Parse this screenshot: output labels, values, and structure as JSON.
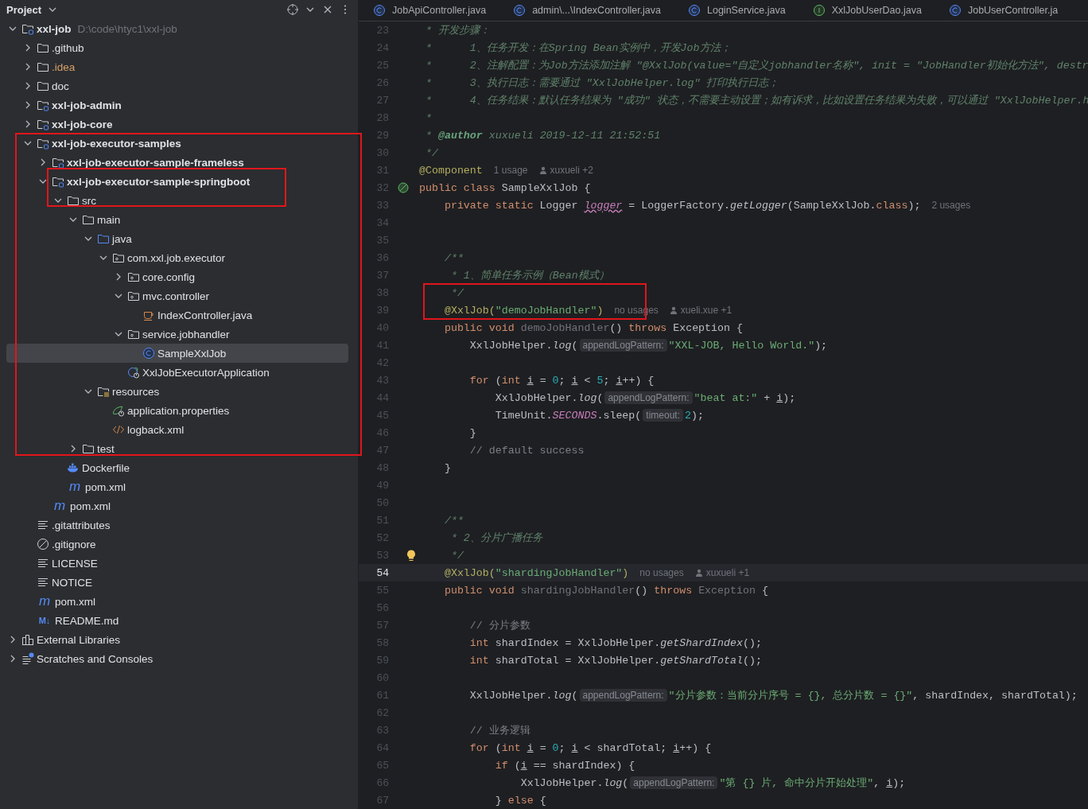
{
  "project_panel": {
    "title": "Project"
  },
  "tree": [
    {
      "label": "xxl-job",
      "kind": "module",
      "path": "D:\\code\\htyc1\\xxl-job",
      "expanded": true,
      "selected": false,
      "children": [
        {
          "label": ".github",
          "kind": "folder",
          "ignored": false,
          "expanded": false,
          "selected": false
        },
        {
          "label": ".idea",
          "kind": "folder",
          "ignored": true,
          "expanded": false,
          "selected": false
        },
        {
          "label": "doc",
          "kind": "folder",
          "ignored": false,
          "expanded": false,
          "selected": false
        },
        {
          "label": "xxl-job-admin",
          "kind": "module",
          "ignored": false,
          "expanded": false,
          "selected": false
        },
        {
          "label": "xxl-job-core",
          "kind": "module",
          "ignored": false,
          "expanded": false,
          "selected": false
        },
        {
          "label": "xxl-job-executor-samples",
          "kind": "module",
          "ignored": false,
          "expanded": true,
          "selected": false,
          "children": [
            {
              "label": "xxl-job-executor-sample-frameless",
              "kind": "module",
              "expanded": false,
              "selected": false
            },
            {
              "label": "xxl-job-executor-sample-springboot",
              "kind": "module",
              "expanded": true,
              "selected": false,
              "children": [
                {
                  "label": "src",
                  "kind": "folder",
                  "expanded": true,
                  "selected": false,
                  "children": [
                    {
                      "label": "main",
                      "kind": "folder",
                      "expanded": true,
                      "selected": false,
                      "children": [
                        {
                          "label": "java",
                          "kind": "source",
                          "expanded": true,
                          "selected": false,
                          "children": [
                            {
                              "label": "com.xxl.job.executor",
                              "kind": "package",
                              "expanded": true,
                              "selected": false,
                              "children": [
                                {
                                  "label": "core.config",
                                  "kind": "package",
                                  "expanded": false,
                                  "selected": false
                                },
                                {
                                  "label": "mvc.controller",
                                  "kind": "package",
                                  "expanded": true,
                                  "selected": false,
                                  "children": [
                                    {
                                      "label": "IndexController.java",
                                      "kind": "javafile",
                                      "selected": false
                                    }
                                  ]
                                },
                                {
                                  "label": "service.jobhandler",
                                  "kind": "package",
                                  "expanded": true,
                                  "selected": false,
                                  "children": [
                                    {
                                      "label": "SampleXxlJob",
                                      "kind": "class",
                                      "selected": true
                                    }
                                  ]
                                },
                                {
                                  "label": "XxlJobExecutorApplication",
                                  "kind": "springapp",
                                  "selected": false
                                }
                              ]
                            }
                          ]
                        },
                        {
                          "label": "resources",
                          "kind": "resources",
                          "expanded": true,
                          "selected": false,
                          "children": [
                            {
                              "label": "application.properties",
                              "kind": "properties",
                              "selected": false
                            },
                            {
                              "label": "logback.xml",
                              "kind": "xml",
                              "selected": false
                            }
                          ]
                        }
                      ]
                    },
                    {
                      "label": "test",
                      "kind": "folder",
                      "expanded": false,
                      "selected": false
                    }
                  ]
                },
                {
                  "label": "Dockerfile",
                  "kind": "docker",
                  "selected": false
                },
                {
                  "label": "pom.xml",
                  "kind": "maven",
                  "icon_text": "m",
                  "selected": false
                }
              ]
            },
            {
              "label": "pom.xml",
              "kind": "maven",
              "icon_text": "m",
              "selected": false
            }
          ]
        },
        {
          "label": ".gitattributes",
          "kind": "text",
          "ignored": false,
          "selected": false
        },
        {
          "label": ".gitignore",
          "kind": "ignore",
          "ignored": false,
          "selected": false
        },
        {
          "label": "LICENSE",
          "kind": "text",
          "ignored": false,
          "selected": false
        },
        {
          "label": "NOTICE",
          "kind": "text",
          "ignored": false,
          "selected": false
        },
        {
          "label": "pom.xml",
          "kind": "maven",
          "icon_text": "m",
          "ignored": false,
          "selected": false
        },
        {
          "label": "README.md",
          "kind": "markdown",
          "icon_text": "M↓",
          "ignored": false,
          "selected": false
        }
      ]
    },
    {
      "label": "External Libraries",
      "kind": "libraries",
      "expanded": false,
      "selected": false
    },
    {
      "label": "Scratches and Consoles",
      "kind": "scratches",
      "expanded": false,
      "selected": false
    }
  ],
  "editor_tabs": [
    {
      "label": "JobApiController.java",
      "kind": "class",
      "selected": false
    },
    {
      "label": "admin\\...\\IndexController.java",
      "kind": "class",
      "selected": false
    },
    {
      "label": "LoginService.java",
      "kind": "class",
      "selected": false
    },
    {
      "label": "XxlJobUserDao.java",
      "kind": "interface",
      "selected": false
    },
    {
      "label": "JobUserController.ja",
      "kind": "class",
      "selected": false
    }
  ],
  "editor": {
    "lines": [
      {
        "number": "23",
        "parts": [
          {
            "kind": "code",
            "tokens": [
              {
                "kind": "doc",
                "text": " * 开发步骤："
              }
            ]
          }
        ]
      },
      {
        "number": "24",
        "parts": [
          {
            "kind": "code",
            "tokens": [
              {
                "kind": "doc",
                "text": " *      1、任务开发：在Spring Bean实例中，开发Job方法；"
              }
            ]
          }
        ]
      },
      {
        "number": "25",
        "parts": [
          {
            "kind": "code",
            "tokens": [
              {
                "kind": "doc",
                "text": " *      2、注解配置：为Job方法添加注解 \"@XxlJob(value=\"自定义jobhandler名称\", init = \"JobHandler初始化方法\", destr"
              }
            ]
          }
        ]
      },
      {
        "number": "26",
        "parts": [
          {
            "kind": "code",
            "tokens": [
              {
                "kind": "doc",
                "text": " *      3、执行日志：需要通过 \"XxlJobHelper.log\" 打印执行日志；"
              }
            ]
          }
        ]
      },
      {
        "number": "27",
        "parts": [
          {
            "kind": "code",
            "tokens": [
              {
                "kind": "doc",
                "text": " *      4、任务结果：默认任务结果为 \"成功\" 状态，不需要主动设置；如有诉求，比如设置任务结果为失败，可以通过 \"XxlJobHelper.h"
              }
            ]
          }
        ]
      },
      {
        "number": "28",
        "parts": [
          {
            "kind": "code",
            "tokens": [
              {
                "kind": "doc",
                "text": " *"
              }
            ]
          }
        ]
      },
      {
        "number": "29",
        "parts": [
          {
            "kind": "code",
            "tokens": [
              {
                "kind": "doc",
                "text": " * "
              },
              {
                "kind": "doctag",
                "text": "@author"
              },
              {
                "kind": "doc",
                "text": " xuxueli 2019-12-11 21:52:51"
              }
            ]
          }
        ]
      },
      {
        "number": "30",
        "parts": [
          {
            "kind": "code",
            "tokens": [
              {
                "kind": "doc",
                "text": " */"
              }
            ]
          }
        ]
      },
      {
        "number": "31",
        "parts": [
          {
            "kind": "code",
            "tokens": [
              {
                "kind": "ann",
                "text": "@Component"
              }
            ]
          },
          {
            "kind": "usage",
            "text": "1 usage"
          },
          {
            "kind": "author",
            "text": "xuxueli +2"
          }
        ]
      },
      {
        "number": "32",
        "gutter": {
          "kind": "bean"
        },
        "parts": [
          {
            "kind": "code",
            "tokens": [
              {
                "kind": "kw",
                "text": "public class "
              },
              {
                "kind": "plain",
                "text": "SampleXxlJob {"
              }
            ]
          }
        ]
      },
      {
        "number": "33",
        "parts": [
          {
            "kind": "code",
            "tokens": [
              {
                "kind": "kw",
                "text": "    private static "
              },
              {
                "kind": "plain",
                "text": "Logger "
              },
              {
                "kind": "field",
                "text": "logger"
              },
              {
                "kind": "plain",
                "text": " = LoggerFactory."
              },
              {
                "kind": "ital",
                "text": "getLogger"
              },
              {
                "kind": "plain",
                "text": "(SampleXxlJob."
              },
              {
                "kind": "kw",
                "text": "class"
              },
              {
                "kind": "plain",
                "text": ");"
              }
            ]
          },
          {
            "kind": "usage",
            "text": "2 usages"
          }
        ]
      },
      {
        "number": "34"
      },
      {
        "number": "35"
      },
      {
        "number": "36",
        "parts": [
          {
            "kind": "code",
            "tokens": [
              {
                "kind": "doc",
                "text": "    /**"
              }
            ]
          }
        ]
      },
      {
        "number": "37",
        "parts": [
          {
            "kind": "code",
            "tokens": [
              {
                "kind": "doc",
                "text": "     * 1、简单任务示例（Bean模式）"
              }
            ]
          }
        ]
      },
      {
        "number": "38",
        "parts": [
          {
            "kind": "code",
            "tokens": [
              {
                "kind": "doc",
                "text": "     */"
              }
            ]
          }
        ]
      },
      {
        "number": "39",
        "parts": [
          {
            "kind": "code",
            "tokens": [
              {
                "kind": "ann",
                "text": "    @XxlJob("
              },
              {
                "kind": "str",
                "text": "\"demoJobHandler\""
              },
              {
                "kind": "ann",
                "text": ")"
              }
            ]
          },
          {
            "kind": "usage",
            "text": "no usages"
          },
          {
            "kind": "author",
            "text": "xueli.xue +1"
          }
        ]
      },
      {
        "number": "40",
        "parts": [
          {
            "kind": "code",
            "tokens": [
              {
                "kind": "kw",
                "text": "    public void "
              },
              {
                "kind": "unused",
                "text": "demoJobHandler"
              },
              {
                "kind": "plain",
                "text": "() "
              },
              {
                "kind": "kw",
                "text": "throws "
              },
              {
                "kind": "plain",
                "text": "Exception {"
              }
            ]
          }
        ]
      },
      {
        "number": "41",
        "parts": [
          {
            "kind": "code",
            "tokens": [
              {
                "kind": "plain",
                "text": "        XxlJobHelper."
              },
              {
                "kind": "ital",
                "text": "log"
              },
              {
                "kind": "plain",
                "text": "("
              }
            ]
          },
          {
            "kind": "hint",
            "text": "appendLogPattern:"
          },
          {
            "kind": "code",
            "tokens": [
              {
                "kind": "str",
                "text": "\"XXL-JOB, Hello World.\""
              },
              {
                "kind": "plain",
                "text": ");"
              }
            ]
          }
        ]
      },
      {
        "number": "42"
      },
      {
        "number": "43",
        "parts": [
          {
            "kind": "code",
            "tokens": [
              {
                "kind": "kw",
                "text": "        for "
              },
              {
                "kind": "plain",
                "text": "("
              },
              {
                "kind": "kw",
                "text": "int "
              },
              {
                "kind": "var",
                "text": "i"
              },
              {
                "kind": "plain",
                "text": " = "
              },
              {
                "kind": "num",
                "text": "0"
              },
              {
                "kind": "plain",
                "text": "; "
              },
              {
                "kind": "var",
                "text": "i"
              },
              {
                "kind": "plain",
                "text": " < "
              },
              {
                "kind": "num",
                "text": "5"
              },
              {
                "kind": "plain",
                "text": "; "
              },
              {
                "kind": "var",
                "text": "i"
              },
              {
                "kind": "plain",
                "text": "++) {"
              }
            ]
          }
        ]
      },
      {
        "number": "44",
        "parts": [
          {
            "kind": "code",
            "tokens": [
              {
                "kind": "plain",
                "text": "            XxlJobHelper."
              },
              {
                "kind": "ital",
                "text": "log"
              },
              {
                "kind": "plain",
                "text": "("
              }
            ]
          },
          {
            "kind": "hint",
            "text": "appendLogPattern:"
          },
          {
            "kind": "code",
            "tokens": [
              {
                "kind": "str",
                "text": "\"beat at:\""
              },
              {
                "kind": "plain",
                "text": " + "
              },
              {
                "kind": "var",
                "text": "i"
              },
              {
                "kind": "plain",
                "text": ");"
              }
            ]
          }
        ]
      },
      {
        "number": "45",
        "parts": [
          {
            "kind": "code",
            "tokens": [
              {
                "kind": "plain",
                "text": "            TimeUnit."
              },
              {
                "kind": "static",
                "text": "SECONDS"
              },
              {
                "kind": "plain",
                "text": ".sleep("
              }
            ]
          },
          {
            "kind": "hint",
            "text": "timeout:"
          },
          {
            "kind": "code",
            "tokens": [
              {
                "kind": "num",
                "text": "2"
              },
              {
                "kind": "plain",
                "text": ");"
              }
            ]
          }
        ]
      },
      {
        "number": "46",
        "parts": [
          {
            "kind": "code",
            "tokens": [
              {
                "kind": "plain",
                "text": "        }"
              }
            ]
          }
        ]
      },
      {
        "number": "47",
        "parts": [
          {
            "kind": "code",
            "tokens": [
              {
                "kind": "cmt",
                "text": "        // default success"
              }
            ]
          }
        ]
      },
      {
        "number": "48",
        "parts": [
          {
            "kind": "code",
            "tokens": [
              {
                "kind": "plain",
                "text": "    }"
              }
            ]
          }
        ]
      },
      {
        "number": "49"
      },
      {
        "number": "50"
      },
      {
        "number": "51",
        "parts": [
          {
            "kind": "code",
            "tokens": [
              {
                "kind": "doc",
                "text": "    /**"
              }
            ]
          }
        ]
      },
      {
        "number": "52",
        "parts": [
          {
            "kind": "code",
            "tokens": [
              {
                "kind": "doc",
                "text": "     * 2、分片广播任务"
              }
            ]
          }
        ]
      },
      {
        "number": "53",
        "gutter": {
          "kind": "bulb"
        },
        "parts": [
          {
            "kind": "code",
            "tokens": [
              {
                "kind": "doc",
                "text": "     */"
              }
            ]
          }
        ]
      },
      {
        "number": "54",
        "current": true,
        "parts": [
          {
            "kind": "code",
            "tokens": [
              {
                "kind": "ann",
                "text": "    @XxlJob("
              },
              {
                "kind": "str",
                "text": "\"shardingJobHandler\""
              },
              {
                "kind": "ann",
                "text": ")"
              }
            ]
          },
          {
            "kind": "usage",
            "text": "no usages"
          },
          {
            "kind": "author",
            "text": "xuxueli +1"
          }
        ]
      },
      {
        "number": "55",
        "parts": [
          {
            "kind": "code",
            "tokens": [
              {
                "kind": "kw",
                "text": "    public void "
              },
              {
                "kind": "unused",
                "text": "shardingJobHandler"
              },
              {
                "kind": "plain",
                "text": "() "
              },
              {
                "kind": "kw",
                "text": "throws "
              },
              {
                "kind": "unused",
                "text": "Exception"
              },
              {
                "kind": "plain",
                "text": " {"
              }
            ]
          }
        ]
      },
      {
        "number": "56"
      },
      {
        "number": "57",
        "parts": [
          {
            "kind": "code",
            "tokens": [
              {
                "kind": "cmt",
                "text": "        // 分片参数"
              }
            ]
          }
        ]
      },
      {
        "number": "58",
        "parts": [
          {
            "kind": "code",
            "tokens": [
              {
                "kind": "kw",
                "text": "        int "
              },
              {
                "kind": "plain",
                "text": "shardIndex = XxlJobHelper."
              },
              {
                "kind": "ital",
                "text": "getShardIndex"
              },
              {
                "kind": "plain",
                "text": "();"
              }
            ]
          }
        ]
      },
      {
        "number": "59",
        "parts": [
          {
            "kind": "code",
            "tokens": [
              {
                "kind": "kw",
                "text": "        int "
              },
              {
                "kind": "plain",
                "text": "shardTotal = XxlJobHelper."
              },
              {
                "kind": "ital",
                "text": "getShardTotal"
              },
              {
                "kind": "plain",
                "text": "();"
              }
            ]
          }
        ]
      },
      {
        "number": "60"
      },
      {
        "number": "61",
        "parts": [
          {
            "kind": "code",
            "tokens": [
              {
                "kind": "plain",
                "text": "        XxlJobHelper."
              },
              {
                "kind": "ital",
                "text": "log"
              },
              {
                "kind": "plain",
                "text": "("
              }
            ]
          },
          {
            "kind": "hint",
            "text": "appendLogPattern:"
          },
          {
            "kind": "code",
            "tokens": [
              {
                "kind": "str",
                "text": "\"分片参数：当前分片序号 = {}, 总分片数 = {}\""
              },
              {
                "kind": "plain",
                "text": ", shardIndex, shardTotal);"
              }
            ]
          }
        ]
      },
      {
        "number": "62"
      },
      {
        "number": "63",
        "parts": [
          {
            "kind": "code",
            "tokens": [
              {
                "kind": "cmt",
                "text": "        // 业务逻辑"
              }
            ]
          }
        ]
      },
      {
        "number": "64",
        "parts": [
          {
            "kind": "code",
            "tokens": [
              {
                "kind": "kw",
                "text": "        for "
              },
              {
                "kind": "plain",
                "text": "("
              },
              {
                "kind": "kw",
                "text": "int "
              },
              {
                "kind": "var",
                "text": "i"
              },
              {
                "kind": "plain",
                "text": " = "
              },
              {
                "kind": "num",
                "text": "0"
              },
              {
                "kind": "plain",
                "text": "; "
              },
              {
                "kind": "var",
                "text": "i"
              },
              {
                "kind": "plain",
                "text": " < shardTotal; "
              },
              {
                "kind": "var",
                "text": "i"
              },
              {
                "kind": "plain",
                "text": "++) {"
              }
            ]
          }
        ]
      },
      {
        "number": "65",
        "parts": [
          {
            "kind": "code",
            "tokens": [
              {
                "kind": "kw",
                "text": "            if "
              },
              {
                "kind": "plain",
                "text": "("
              },
              {
                "kind": "var",
                "text": "i"
              },
              {
                "kind": "plain",
                "text": " == shardIndex) {"
              }
            ]
          }
        ]
      },
      {
        "number": "66",
        "parts": [
          {
            "kind": "code",
            "tokens": [
              {
                "kind": "plain",
                "text": "                XxlJobHelper."
              },
              {
                "kind": "ital",
                "text": "log"
              },
              {
                "kind": "plain",
                "text": "("
              }
            ]
          },
          {
            "kind": "hint",
            "text": "appendLogPattern:"
          },
          {
            "kind": "code",
            "tokens": [
              {
                "kind": "str",
                "text": "\"第 {} 片, 命中分片开始处理\""
              },
              {
                "kind": "plain",
                "text": ", "
              },
              {
                "kind": "var",
                "text": "i"
              },
              {
                "kind": "plain",
                "text": ");"
              }
            ]
          }
        ]
      },
      {
        "number": "67",
        "parts": [
          {
            "kind": "code",
            "tokens": [
              {
                "kind": "plain",
                "text": "            } "
              },
              {
                "kind": "kw",
                "text": "else "
              },
              {
                "kind": "plain",
                "text": "{"
              }
            ]
          }
        ]
      }
    ]
  }
}
